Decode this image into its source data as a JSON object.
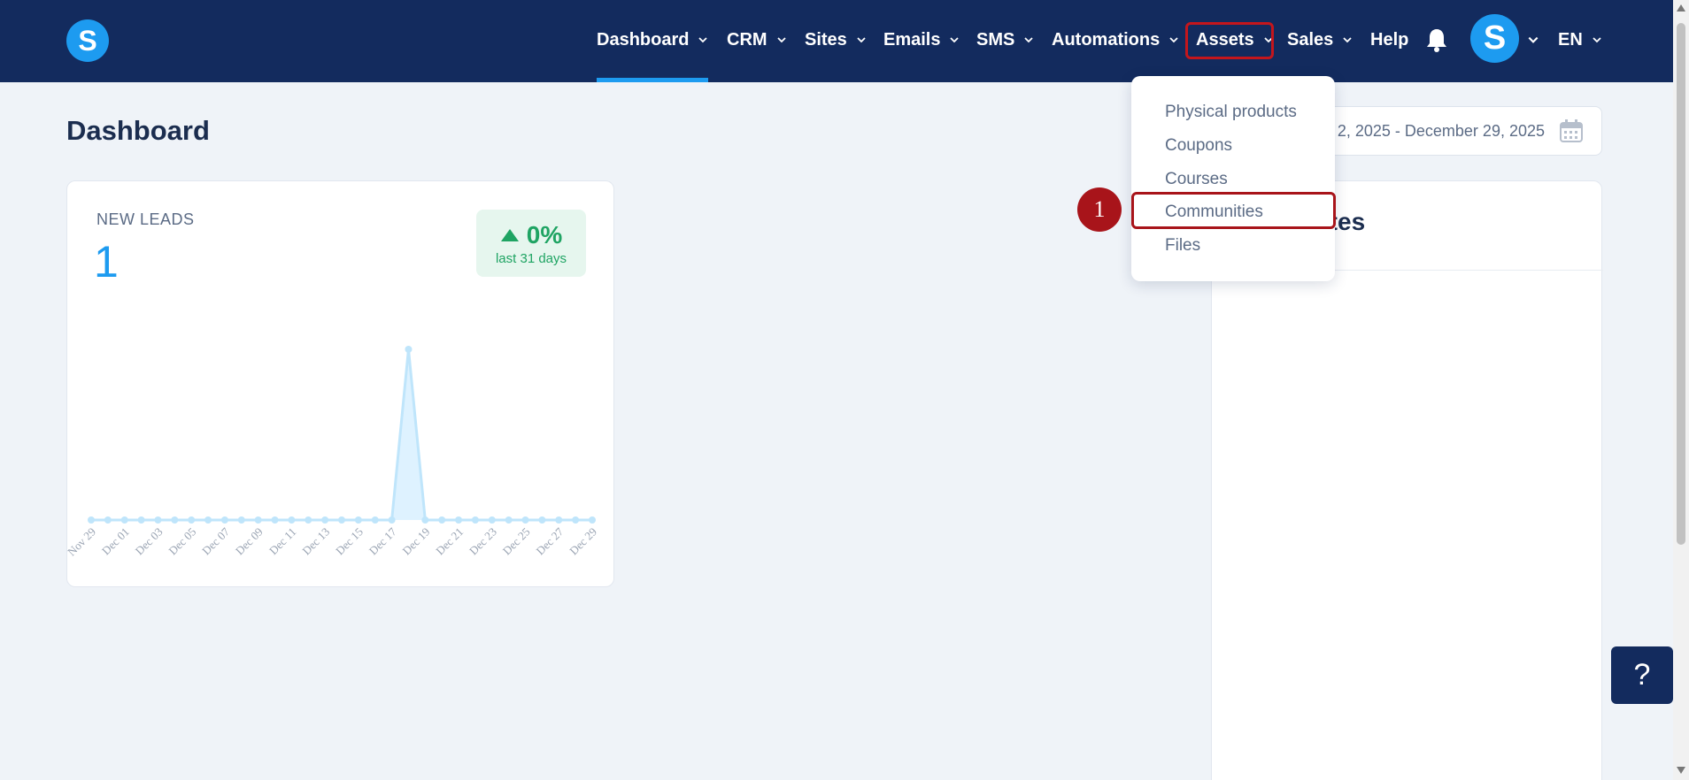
{
  "nav": {
    "logo_letter": "S",
    "items": [
      {
        "label": "Dashboard",
        "has_chevron": true
      },
      {
        "label": "CRM",
        "has_chevron": true
      },
      {
        "label": "Sites",
        "has_chevron": true
      },
      {
        "label": "Emails",
        "has_chevron": true
      },
      {
        "label": "SMS",
        "has_chevron": true
      },
      {
        "label": "Automations",
        "has_chevron": true
      },
      {
        "label": "Assets",
        "has_chevron": true
      },
      {
        "label": "Sales",
        "has_chevron": true
      },
      {
        "label": "Help",
        "has_chevron": false
      }
    ],
    "avatar_letter": "S",
    "language": "EN"
  },
  "page": {
    "title": "Dashboard",
    "date_range": "2, 2025 - December 29, 2025"
  },
  "leads_card": {
    "label": "NEW LEADS",
    "value": "1",
    "change": "0%",
    "change_period": "last 31 days"
  },
  "updates_card": {
    "title_visible": "dates"
  },
  "assets_menu": {
    "items": [
      "Physical products",
      "Coupons",
      "Courses",
      "Communities",
      "Files"
    ]
  },
  "annotation": {
    "step": "1"
  },
  "help_button": {
    "label": "?"
  },
  "colors": {
    "navbar": "#132b5e",
    "accent": "#1d9bf0",
    "highlight": "#a8141a",
    "positive": "#1fa463"
  },
  "chart_data": {
    "type": "area",
    "x": [
      "Nov 29",
      "Nov 30",
      "Dec 01",
      "Dec 02",
      "Dec 03",
      "Dec 04",
      "Dec 05",
      "Dec 06",
      "Dec 07",
      "Dec 08",
      "Dec 09",
      "Dec 10",
      "Dec 11",
      "Dec 12",
      "Dec 13",
      "Dec 14",
      "Dec 15",
      "Dec 16",
      "Dec 17",
      "Dec 18",
      "Dec 19",
      "Dec 20",
      "Dec 21",
      "Dec 22",
      "Dec 23",
      "Dec 24",
      "Dec 25",
      "Dec 26",
      "Dec 27",
      "Dec 28",
      "Dec 29"
    ],
    "tick_labels": [
      "Nov 29",
      "Dec 01",
      "Dec 03",
      "Dec 05",
      "Dec 07",
      "Dec 09",
      "Dec 11",
      "Dec 13",
      "Dec 15",
      "Dec 17",
      "Dec 19",
      "Dec 21",
      "Dec 23",
      "Dec 25",
      "Dec 27",
      "Dec 29"
    ],
    "series": [
      {
        "values": [
          0,
          0,
          0,
          0,
          0,
          0,
          0,
          0,
          0,
          0,
          0,
          0,
          0,
          0,
          0,
          0,
          0,
          0,
          0,
          1,
          0,
          0,
          0,
          0,
          0,
          0,
          0,
          0,
          0,
          0,
          0
        ]
      }
    ],
    "ylim": [
      0,
      1
    ],
    "grid": false,
    "legend": "none"
  }
}
